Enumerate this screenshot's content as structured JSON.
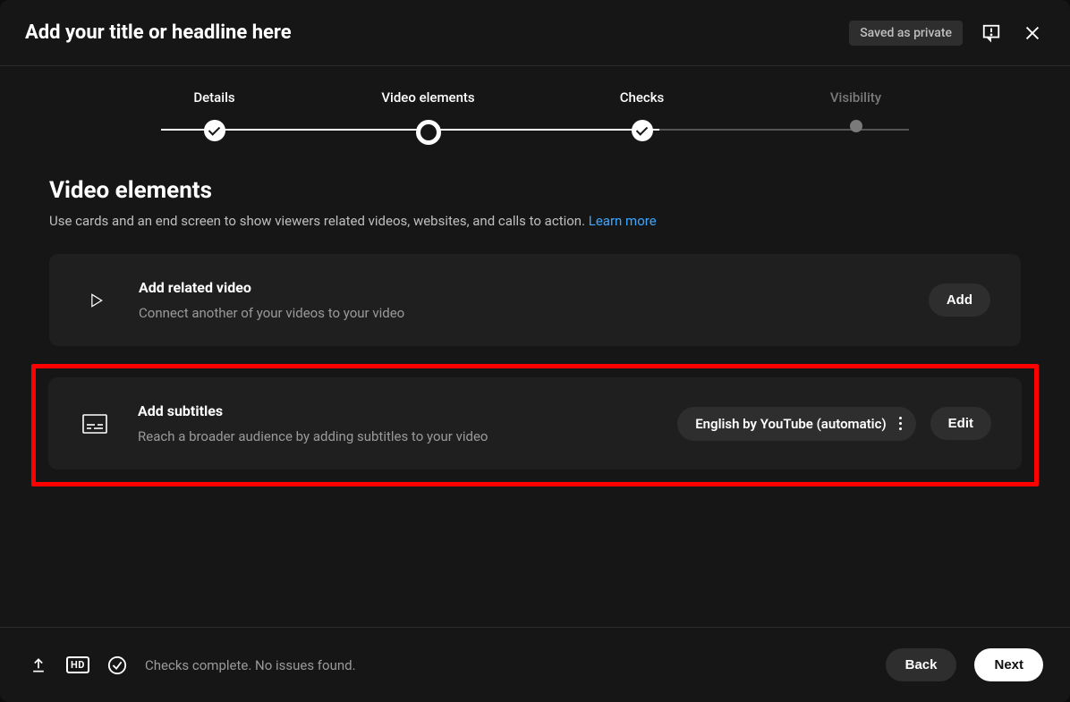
{
  "header": {
    "title": "Add your title or headline here",
    "saved_chip": "Saved as private"
  },
  "stepper": {
    "steps": [
      {
        "label": "Details"
      },
      {
        "label": "Video elements"
      },
      {
        "label": "Checks"
      },
      {
        "label": "Visibility"
      }
    ]
  },
  "section": {
    "title": "Video elements",
    "description": "Use cards and an end screen to show viewers related videos, websites, and calls to action. ",
    "learn_more": "Learn more"
  },
  "cards": {
    "related": {
      "title": "Add related video",
      "description": "Connect another of your videos to your video",
      "button": "Add"
    },
    "subtitles": {
      "title": "Add subtitles",
      "description": "Reach a broader audience by adding subtitles to your video",
      "language_chip": "English by YouTube (automatic)",
      "button": "Edit"
    }
  },
  "footer": {
    "hd_label": "HD",
    "status": "Checks complete. No issues found.",
    "back": "Back",
    "next": "Next"
  }
}
